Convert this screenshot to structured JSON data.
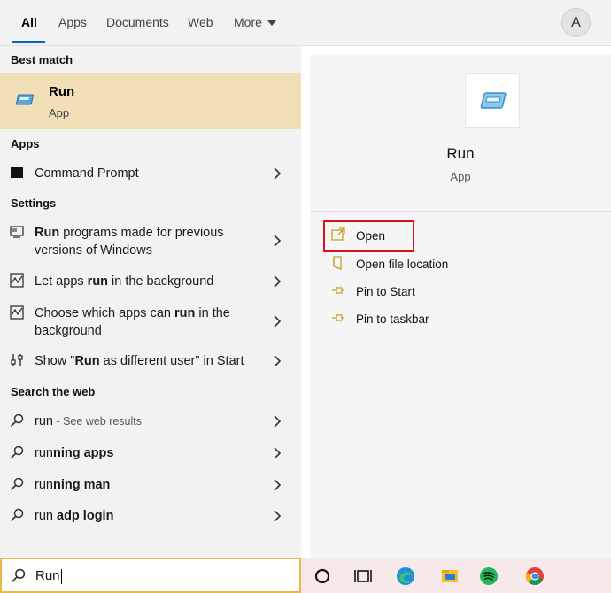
{
  "tabs": {
    "all": "All",
    "apps": "Apps",
    "documents": "Documents",
    "web": "Web",
    "more": "More",
    "avatar_letter": "A"
  },
  "left": {
    "best_match_heading": "Best match",
    "best_match": {
      "title": "Run",
      "subtitle": "App"
    },
    "apps_heading": "Apps",
    "apps": [
      {
        "label": "Command Prompt",
        "icon": "console-icon"
      }
    ],
    "settings_heading": "Settings",
    "settings": [
      {
        "pre": "",
        "bold": "Run",
        "post": " programs made for previous versions of Windows",
        "icon": "compat-icon"
      },
      {
        "pre": "Let apps ",
        "bold": "run",
        "post": " in the background",
        "icon": "activity-icon"
      },
      {
        "pre": "Choose which apps can ",
        "bold": "run",
        "post": " in the background",
        "icon": "activity-icon"
      },
      {
        "pre": "Show \"",
        "bold": "Run",
        "post": " as different user\" in Start",
        "icon": "settings-sliders-icon"
      }
    ],
    "web_heading": "Search the web",
    "web": [
      {
        "pre": "run",
        "bold": "",
        "muted": " - See web results"
      },
      {
        "pre": "run",
        "bold": "ning apps",
        "muted": ""
      },
      {
        "pre": "run",
        "bold": "ning man",
        "muted": ""
      },
      {
        "pre": "run ",
        "bold": "adp login",
        "muted": ""
      }
    ]
  },
  "right": {
    "app_title": "Run",
    "app_subtitle": "App",
    "actions": [
      {
        "label": "Open",
        "icon": "open-icon"
      },
      {
        "label": "Open file location",
        "icon": "file-location-icon"
      },
      {
        "label": "Pin to Start",
        "icon": "pin-icon"
      },
      {
        "label": "Pin to taskbar",
        "icon": "pin-icon"
      }
    ]
  },
  "search": {
    "value": "Run"
  },
  "taskbar": {
    "icons": [
      "cortana-icon",
      "task-view-icon",
      "edge-icon",
      "file-explorer-icon",
      "spotify-icon",
      "chrome-icon"
    ]
  },
  "colors": {
    "highlight": "#f0dfb7",
    "accent": "#0067c0",
    "annotation_box": "#d6141b",
    "search_border": "#e8b84a"
  }
}
